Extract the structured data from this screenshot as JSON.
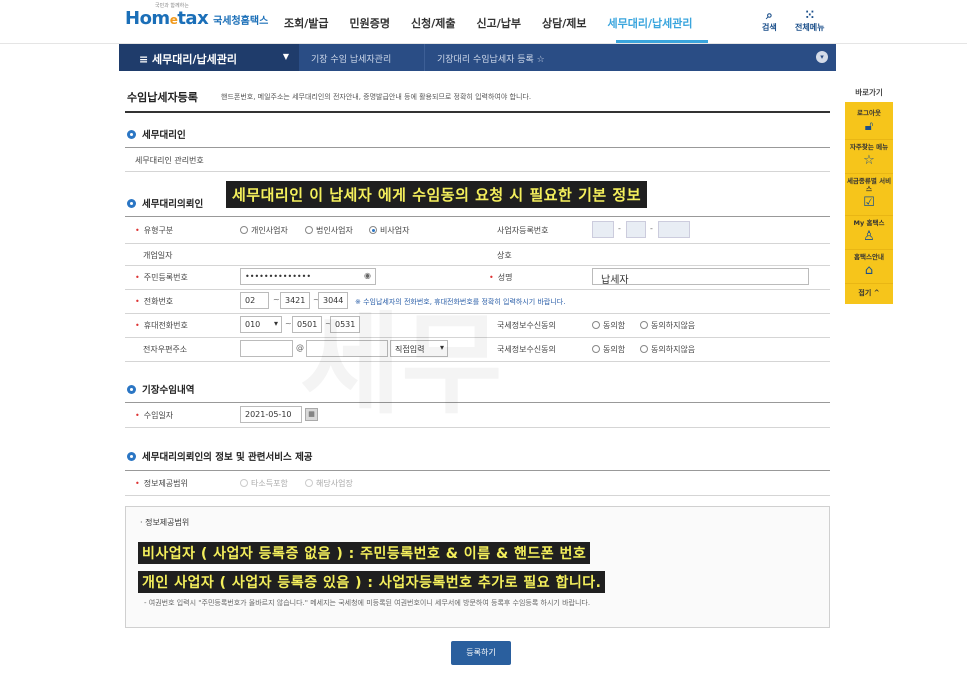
{
  "header": {
    "logo_main_1": "Hom",
    "logo_main_e": "e",
    "logo_main_2": "tax",
    "logo_sub": "국세청홈택스",
    "logo_tag": "국민과 함께하는",
    "menu": [
      "조회/발급",
      "민원증명",
      "신청/제출",
      "신고/납부",
      "상담/제보",
      "세무대리/납세관리"
    ],
    "search_label": "검색",
    "allmenu_label": "전체메뉴"
  },
  "subnav": {
    "section": "세무대리/납세관리",
    "crumb1": "기장 수임 납세자관리",
    "crumb2": "기장대리 수임납세자 등록 ☆"
  },
  "page": {
    "title": "수임납세자등록",
    "desc": "핸드폰번호, 메일주소는 세무대리인의 전자안내, 증명발급안내 등에 활용되므로 정확히 입력하여야 합니다."
  },
  "sec1": {
    "title": "세무대리인",
    "row_label": "세무대리인 관리번호"
  },
  "sec2": {
    "title": "세무대리의뢰인",
    "type_label": "유형구분",
    "type_options": [
      "개인사업자",
      "법인사업자",
      "비사업자"
    ],
    "brn_label": "사업자등록번호",
    "open_date_label": "개업일자",
    "trade_name_label": "상호",
    "rrn_label": "주민등록번호",
    "rrn_value": "••••••••••••••",
    "name_label": "성명",
    "name_value": "납세자",
    "phone_label": "전화번호",
    "phone": [
      "02",
      "3421",
      "3044"
    ],
    "phone_note": "※ 수임납세자의 전화번호, 휴대전화번호를 정확히 입력하시기 바랍니다.",
    "mobile_label": "휴대전화번호",
    "mobile": [
      "010",
      "0501",
      "0531"
    ],
    "email_label": "전자우편주소",
    "email_at": "@",
    "email_select": "직접입력",
    "consent1_label": "국세정보수신동의",
    "consent2_label": "국세정보수신동의",
    "consent_options": [
      "동의함",
      "동의하지않음"
    ]
  },
  "sec3": {
    "title": "기장수임내역",
    "date_label": "수임일자",
    "date_value": "2021-05-10"
  },
  "sec4": {
    "title": "세무대리의뢰인의 정보 및 관련서비스 제공",
    "scope_label": "정보제공범위",
    "scope_options": [
      "타소득포함",
      "해당사업장"
    ]
  },
  "infobox": {
    "title": "· 정보제공범위",
    "line_last": "- 여권번호 입력시 \"주민등록번호가 올바르지 않습니다.\" 메세지는 국세청에 미등록된 여권번호이니 세무서에 방문하여 등록후 수임등록 하시기 바랍니다."
  },
  "submit_label": "등록하기",
  "captions": {
    "cap1": "세무대리인 이  납세자 에게 수임동의 요청 시 필요한 기본 정보",
    "cap2": "비사업자 ( 사업자 등록증 없음 ) : 주민등록번호  &  이름  & 핸드폰 번호",
    "cap3": "개인 사업자 ( 사업자 등록증 있음 ) : 사업자등록번호  추가로  필요  합니다."
  },
  "watermark": "세무",
  "quick": {
    "title": "바로가기",
    "items": [
      "로그아웃",
      "자주찾는 메뉴",
      "세금종류별 서비스",
      "My 홈택스",
      "홈택스안내"
    ],
    "fold": "접기 ^"
  },
  "colors": {
    "brand_blue": "#1b6fb8",
    "nav_dark": "#2a4d85",
    "active_tab": "#3aa5dd",
    "quick_yellow": "#f6c51b",
    "caption_text": "#f4ef5c"
  }
}
